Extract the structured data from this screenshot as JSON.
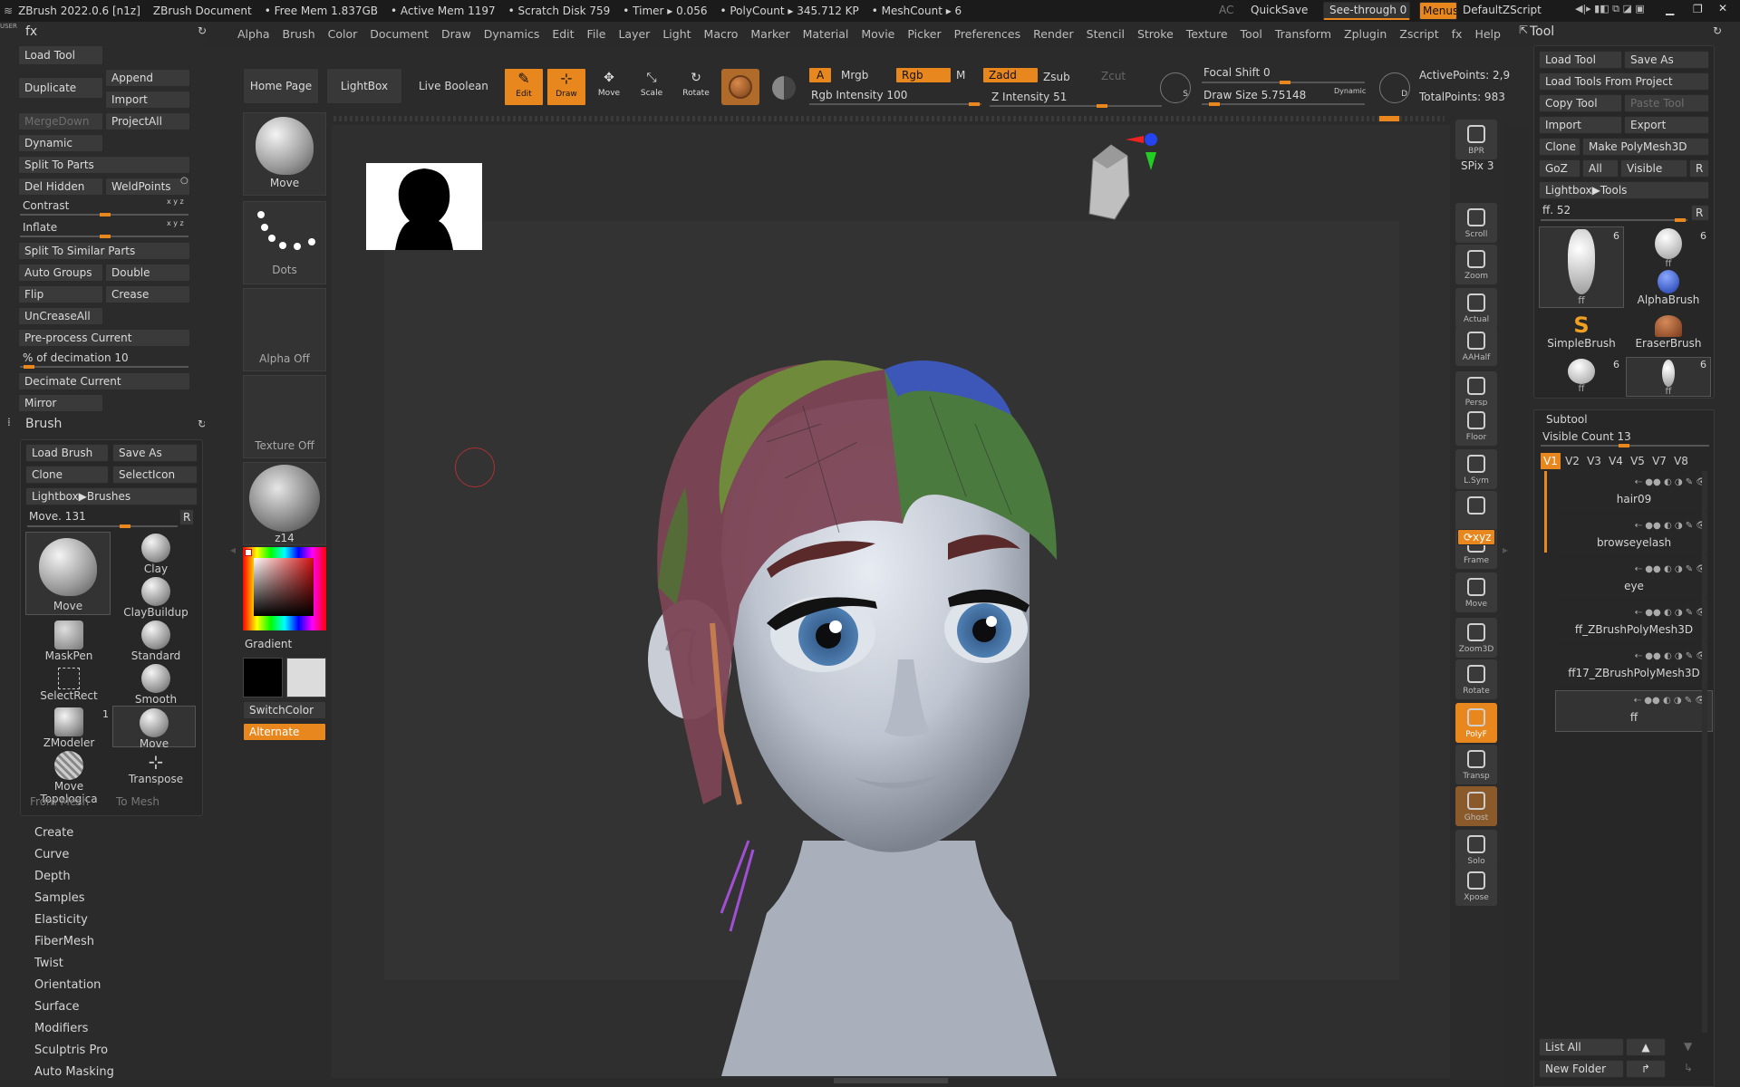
{
  "titlebar": {
    "app": "ZBrush 2022.0.6 [n1z]",
    "doc": "ZBrush Document",
    "free_mem": "• Free Mem 1.837GB",
    "active_mem": "• Active Mem 1197",
    "scratch": "• Scratch Disk 759",
    "timer": "• Timer ▸ 0.056",
    "polycount": "• PolyCount ▸ 345.712 KP",
    "meshcount": "• MeshCount ▸ 6",
    "ac": "AC",
    "quicksave": "QuickSave",
    "seethrough": "See-through 0",
    "menus": "Menus",
    "defaultzscript": "DefaultZScript"
  },
  "menu": [
    "Alpha",
    "Brush",
    "Color",
    "Document",
    "Draw",
    "Dynamics",
    "Edit",
    "File",
    "Layer",
    "Light",
    "Macro",
    "Marker",
    "Material",
    "Movie",
    "Picker",
    "Preferences",
    "Render",
    "Stencil",
    "Stroke",
    "Texture",
    "Tool",
    "Transform",
    "Zplugin",
    "Zscript",
    "fx",
    "Help"
  ],
  "left": {
    "user": "USER",
    "fx": "fx",
    "load_tool": "Load Tool",
    "duplicate": "Duplicate",
    "append": "Append",
    "import": "Import",
    "mergedown": "MergeDown",
    "projectall": "ProjectAll",
    "dynamic": "Dynamic",
    "split_to_parts": "Split To Parts",
    "del_hidden": "Del Hidden",
    "weldpoints": "WeldPoints",
    "contrast": "Contrast",
    "inflate": "Inflate",
    "split_similar": "Split To Similar Parts",
    "auto_groups": "Auto Groups",
    "double": "Double",
    "flip": "Flip",
    "crease": "Crease",
    "uncreaseall": "UnCreaseAll",
    "preprocess": "Pre-process Current",
    "decimation": "% of decimation 10",
    "decimate_current": "Decimate Current",
    "mirror": "Mirror",
    "brush_title": "Brush",
    "load_brush": "Load Brush",
    "save_as": "Save As",
    "clone": "Clone",
    "selecticon": "SelectIcon",
    "lightbox_brushes": "Lightbox▶Brushes",
    "move_value": "Move. 131",
    "r": "R",
    "brushes": [
      "Move",
      "Clay",
      "ClayBuildup",
      "MaskPen",
      "Standard",
      "SelectRect",
      "Smooth",
      "ZModeler",
      "Move",
      "Move Topologica",
      "Transpose"
    ],
    "zmodeler_count": "1",
    "from_mesh": "From Mesh",
    "to_mesh": "To Mesh",
    "sections": [
      "Create",
      "Curve",
      "Depth",
      "Samples",
      "Elasticity",
      "FiberMesh",
      "Twist",
      "Orientation",
      "Surface",
      "Modifiers",
      "Sculptris Pro",
      "Auto Masking"
    ]
  },
  "toolbar": {
    "home": "Home Page",
    "lightbox": "LightBox",
    "live_boolean": "Live Boolean",
    "edit": "Edit",
    "draw": "Draw",
    "move": "Move",
    "scale": "Scale",
    "rotate": "Rotate",
    "a": "A",
    "mrgb": "Mrgb",
    "rgb": "Rgb",
    "m": "M",
    "zadd": "Zadd",
    "zsub": "Zsub",
    "zcut": "Zcut",
    "rgb_intensity": "Rgb Intensity 100",
    "z_intensity": "Z Intensity 51",
    "focal_shift": "Focal Shift 0",
    "draw_size": "Draw Size 5.75148",
    "dynamic": "Dynamic",
    "active_points": "ActivePoints: 2,9",
    "total_points": "TotalPoints: 983"
  },
  "shelf": {
    "move": "Move",
    "dots": "Dots",
    "alpha_off": "Alpha Off",
    "texture_off": "Texture Off",
    "z14": "z14",
    "gradient": "Gradient",
    "switchcolor": "SwitchColor",
    "alternate": "Alternate"
  },
  "righttools": [
    "BPR",
    "SPix 3",
    "Scroll",
    "Zoom",
    "Actual",
    "AAHalf",
    "Persp",
    "Floor",
    "L.Sym",
    "",
    "Frame",
    "Move",
    "Zoom3D",
    "Rotate",
    "PolyF",
    "Transp",
    "Ghost",
    "Solo",
    "Xpose"
  ],
  "tool": {
    "title": "Tool",
    "load_tool": "Load Tool",
    "save_as": "Save As",
    "load_from_project": "Load Tools From Project",
    "copy_tool": "Copy Tool",
    "paste_tool": "Paste Tool",
    "import": "Import",
    "export": "Export",
    "clone": "Clone",
    "make_polymesh": "Make PolyMesh3D",
    "goz": "GoZ",
    "all": "All",
    "visible": "Visible",
    "r": "R",
    "lightbox_tools": "Lightbox▶Tools",
    "ff_value": "ff. 52",
    "thumbs": [
      "ff",
      "ff",
      "AlphaBrush",
      "SimpleBrush",
      "EraserBrush",
      "ff",
      "ff"
    ],
    "thumb_count": "6"
  },
  "subtool": {
    "title": "Subtool",
    "visible_count": "Visible Count 13",
    "versions": [
      "V1",
      "V2",
      "V3",
      "V4",
      "V5",
      "V7",
      "V8"
    ],
    "rows": [
      "hair09",
      "browseyelash",
      "eye",
      "ff_ZBrushPolyMesh3D",
      "ff17_ZBrushPolyMesh3D",
      "ff"
    ],
    "list_all": "List All",
    "new_folder": "New Folder"
  }
}
